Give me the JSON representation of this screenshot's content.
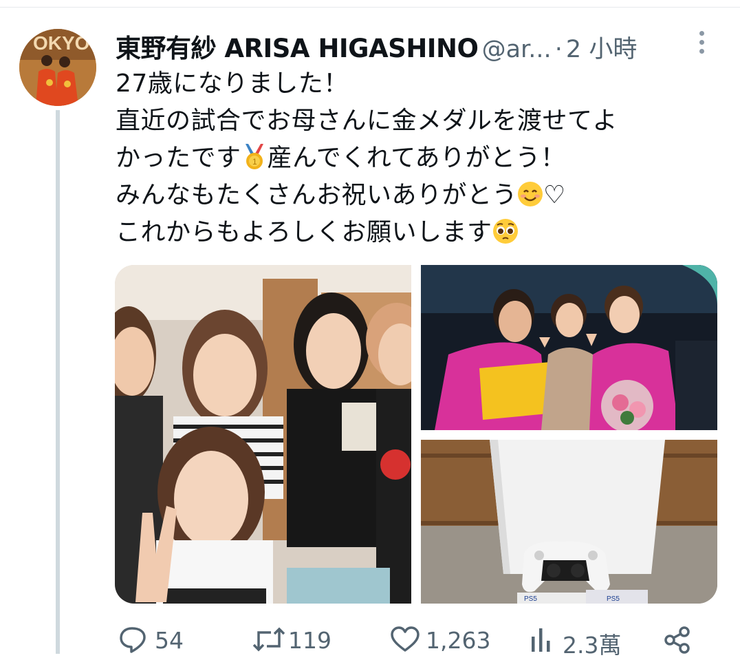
{
  "tweet": {
    "author_name": "東野有紗 ARISA HIGASHINO",
    "handle": "@ar...",
    "separator": "·",
    "time": "2 小時",
    "lines": [
      "27歳になりました！",
      "直近の試合でお母さんに金メダルを渡せてよ",
      "かったです",
      "産んでくれてありがとう！",
      "みんなもたくさんお祝いありがとう",
      "♡",
      "これからもよろしくお願いします"
    ],
    "avatar_text": "OKYO"
  },
  "media": {
    "photos": [
      "group-selfie-photo",
      "medal-ceremony-photo",
      "ps5-console-photo"
    ],
    "ps5_box_text": "PS5"
  },
  "actions": {
    "replies": "54",
    "retweets": "119",
    "likes": "1,263",
    "views": "2.3萬"
  },
  "colors": {
    "text": "#0f1419",
    "secondary": "#536471",
    "thread_line": "#cfd9de"
  }
}
